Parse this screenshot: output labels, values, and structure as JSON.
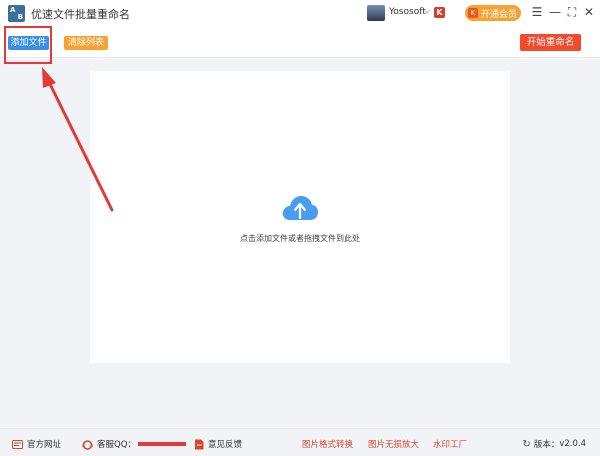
{
  "app": {
    "title": "优速文件批量重命名",
    "icon_glyph_a": "A",
    "icon_glyph_b": "B"
  },
  "user": {
    "name": "Yososoft",
    "caret": "⌵",
    "badge_glyph": "K",
    "vip_label": "开通会员",
    "vip_icon_glyph": "K"
  },
  "window_controls": {
    "menu": "☰",
    "minimize": "—",
    "maximize": "⛶",
    "close": "✕"
  },
  "toolbar": {
    "add_files_label": "添加文件",
    "clear_list_label": "清除列表",
    "start_rename_label": "开始重命名"
  },
  "main": {
    "drop_hint": "点击添加文件或者拖拽文件到此处"
  },
  "footer": {
    "website_label": "官方网址",
    "support_qq_label": "客服QQ：",
    "feedback_label": "意见反馈",
    "link_image_convert": "图片格式转换",
    "link_image_enlarge": "图片无损放大",
    "link_watermark": "水印工厂",
    "version_label": "版本：",
    "version_value": "v2.0.4"
  },
  "colors": {
    "accent_blue": "#3b8fe8",
    "accent_orange": "#f7a233",
    "accent_red": "#f24a2f",
    "annotation_red": "#e53935",
    "background": "#f1f3f7"
  }
}
